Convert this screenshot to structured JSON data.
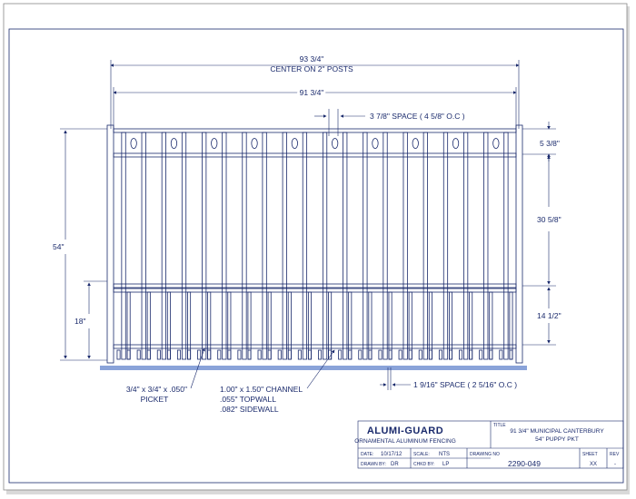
{
  "dimensions": {
    "center_on_posts": "93 3/4\"",
    "center_on_posts_label": "CENTER ON 2\" POSTS",
    "inner_width": "91 3/4\"",
    "top_space": "3 7/8\" SPACE ( 4 5/8\" O.C )",
    "top_finial_height": "5 3/8\"",
    "upper_section_height": "30 5/8\"",
    "lower_section_height": "14 1/2\"",
    "overall_height": "54\"",
    "bottom_section_height": "18\"",
    "bottom_space": "1 9/16\" SPACE ( 2 5/16\" O.C )"
  },
  "callouts": {
    "picket_line1": "3/4\" x 3/4\" x .050\"",
    "picket_line2": "PICKET",
    "channel_line1": "1.00\" x 1.50\" CHANNEL",
    "channel_line2": ".055\" TOPWALL",
    "channel_line3": ".082\" SIDEWALL"
  },
  "title_block": {
    "company": "ALUMI-GUARD",
    "subtitle": "ORNAMENTAL ALUMINUM FENCING",
    "title_label": "TITLE",
    "title_line1": "91 3/4\" MUNICIPAL CANTERBURY",
    "title_line2": "54\" PUPPY PKT",
    "date_label": "DATE:",
    "date_value": "10/17/12",
    "scale_label": "SCALE:",
    "scale_value": "NTS",
    "drawn_label": "DRAWN BY:",
    "drawn_value": "DR",
    "chkd_label": "CHKD BY:",
    "chkd_value": "LP",
    "drawing_no_label": "DRAWING NO",
    "drawing_no_value": "2290-049",
    "sheet_label": "SHEET",
    "sheet_value": "XX",
    "rev_label": "REV",
    "rev_value": "-"
  }
}
